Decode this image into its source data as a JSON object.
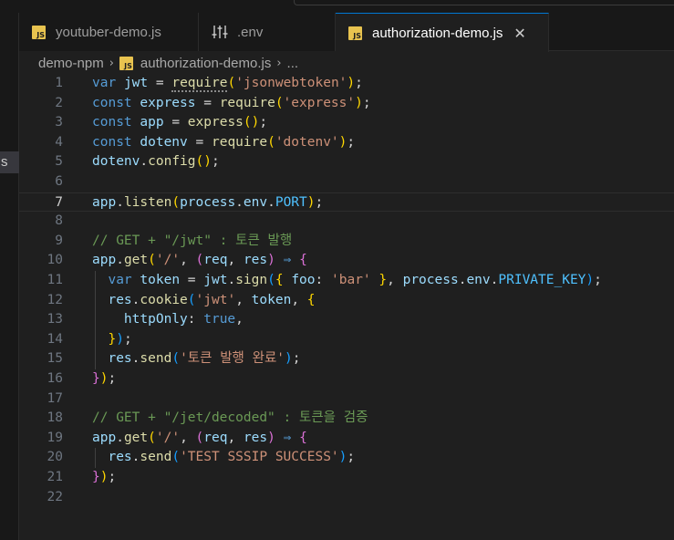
{
  "activity_bar": {
    "fragment": "s",
    "top_fragment": ""
  },
  "tabs": [
    {
      "label": "youtuber-demo.js",
      "icon": "js-file-icon",
      "icon_text": "JS"
    },
    {
      "label": ".env",
      "icon": "settings-sliders-icon"
    },
    {
      "label": "authorization-demo.js",
      "icon": "js-file-icon",
      "icon_text": "JS",
      "active": true,
      "close": "✕"
    }
  ],
  "breadcrumb": {
    "folder": "demo-npm",
    "file": "authorization-demo.js",
    "more": "...",
    "sep": "›",
    "icon_text": "JS"
  },
  "editor": {
    "current_line": 7,
    "colors": {
      "keyword": "#569cd6",
      "variable": "#9cdcfe",
      "function": "#dcdcaa",
      "string": "#ce9178",
      "comment": "#6a9955",
      "constant": "#4fc1ff"
    },
    "lines": [
      [
        [
          "kw",
          "var"
        ],
        [
          "p",
          " "
        ],
        [
          "vr",
          "jwt"
        ],
        [
          "p",
          " = "
        ],
        [
          "fn",
          "require"
        ],
        [
          "b1",
          "("
        ],
        [
          "st",
          "'jsonwebtoken'"
        ],
        [
          "b1",
          ")"
        ],
        [
          "p",
          ";"
        ]
      ],
      [
        [
          "kw",
          "const"
        ],
        [
          "p",
          " "
        ],
        [
          "vr",
          "express"
        ],
        [
          "p",
          " = "
        ],
        [
          "fn",
          "require"
        ],
        [
          "b1",
          "("
        ],
        [
          "st",
          "'express'"
        ],
        [
          "b1",
          ")"
        ],
        [
          "p",
          ";"
        ]
      ],
      [
        [
          "kw",
          "const"
        ],
        [
          "p",
          " "
        ],
        [
          "vr",
          "app"
        ],
        [
          "p",
          " = "
        ],
        [
          "fn",
          "express"
        ],
        [
          "b1",
          "()"
        ],
        [
          "p",
          ";"
        ]
      ],
      [
        [
          "kw",
          "const"
        ],
        [
          "p",
          " "
        ],
        [
          "vr",
          "dotenv"
        ],
        [
          "p",
          " = "
        ],
        [
          "fn",
          "require"
        ],
        [
          "b1",
          "("
        ],
        [
          "st",
          "'dotenv'"
        ],
        [
          "b1",
          ")"
        ],
        [
          "p",
          ";"
        ]
      ],
      [
        [
          "vr",
          "dotenv"
        ],
        [
          "p",
          "."
        ],
        [
          "fn",
          "config"
        ],
        [
          "b1",
          "()"
        ],
        [
          "p",
          ";"
        ]
      ],
      [],
      [
        [
          "vr",
          "app"
        ],
        [
          "p",
          "."
        ],
        [
          "fn",
          "listen"
        ],
        [
          "b1",
          "("
        ],
        [
          "vr",
          "process"
        ],
        [
          "p",
          "."
        ],
        [
          "vr",
          "env"
        ],
        [
          "p",
          "."
        ],
        [
          "cn",
          "PORT"
        ],
        [
          "b1",
          ")"
        ],
        [
          "p",
          ";"
        ]
      ],
      [],
      [
        [
          "cm",
          "// GET + \"/jwt\" : 토큰 발행"
        ]
      ],
      [
        [
          "vr",
          "app"
        ],
        [
          "p",
          "."
        ],
        [
          "fn",
          "get"
        ],
        [
          "b1",
          "("
        ],
        [
          "st",
          "'/'"
        ],
        [
          "p",
          ", "
        ],
        [
          "b2",
          "("
        ],
        [
          "vr",
          "req"
        ],
        [
          "p",
          ", "
        ],
        [
          "vr",
          "res"
        ],
        [
          "b2",
          ")"
        ],
        [
          "p",
          " "
        ],
        [
          "kw",
          "⇒"
        ],
        [
          "p",
          " "
        ],
        [
          "b2",
          "{"
        ]
      ],
      [
        [
          "p",
          "  "
        ],
        [
          "kw",
          "var"
        ],
        [
          "p",
          " "
        ],
        [
          "vr",
          "token"
        ],
        [
          "p",
          " = "
        ],
        [
          "vr",
          "jwt"
        ],
        [
          "p",
          "."
        ],
        [
          "fn",
          "sign"
        ],
        [
          "b3",
          "("
        ],
        [
          "b1",
          "{"
        ],
        [
          "p",
          " "
        ],
        [
          "vr",
          "foo"
        ],
        [
          "p",
          ": "
        ],
        [
          "st",
          "'bar'"
        ],
        [
          "p",
          " "
        ],
        [
          "b1",
          "}"
        ],
        [
          "p",
          ", "
        ],
        [
          "vr",
          "process"
        ],
        [
          "p",
          "."
        ],
        [
          "vr",
          "env"
        ],
        [
          "p",
          "."
        ],
        [
          "cn",
          "PRIVATE_KEY"
        ],
        [
          "b3",
          ")"
        ],
        [
          "p",
          ";"
        ]
      ],
      [
        [
          "p",
          "  "
        ],
        [
          "vr",
          "res"
        ],
        [
          "p",
          "."
        ],
        [
          "fn",
          "cookie"
        ],
        [
          "b3",
          "("
        ],
        [
          "st",
          "'jwt'"
        ],
        [
          "p",
          ", "
        ],
        [
          "vr",
          "token"
        ],
        [
          "p",
          ", "
        ],
        [
          "b1",
          "{"
        ]
      ],
      [
        [
          "p",
          "    "
        ],
        [
          "vr",
          "httpOnly"
        ],
        [
          "p",
          ": "
        ],
        [
          "kw",
          "true"
        ],
        [
          "p",
          ","
        ]
      ],
      [
        [
          "p",
          "  "
        ],
        [
          "b1",
          "}"
        ],
        [
          "b3",
          ")"
        ],
        [
          "p",
          ";"
        ]
      ],
      [
        [
          "p",
          "  "
        ],
        [
          "vr",
          "res"
        ],
        [
          "p",
          "."
        ],
        [
          "fn",
          "send"
        ],
        [
          "b3",
          "("
        ],
        [
          "st",
          "'토큰 발행 완료'"
        ],
        [
          "b3",
          ")"
        ],
        [
          "p",
          ";"
        ]
      ],
      [
        [
          "b2",
          "}"
        ],
        [
          "b1",
          ")"
        ],
        [
          "p",
          ";"
        ]
      ],
      [],
      [
        [
          "cm",
          "// GET + \"/jet/decoded\" : 토큰을 검증"
        ]
      ],
      [
        [
          "vr",
          "app"
        ],
        [
          "p",
          "."
        ],
        [
          "fn",
          "get"
        ],
        [
          "b1",
          "("
        ],
        [
          "st",
          "'/'"
        ],
        [
          "p",
          ", "
        ],
        [
          "b2",
          "("
        ],
        [
          "vr",
          "req"
        ],
        [
          "p",
          ", "
        ],
        [
          "vr",
          "res"
        ],
        [
          "b2",
          ")"
        ],
        [
          "p",
          " "
        ],
        [
          "kw",
          "⇒"
        ],
        [
          "p",
          " "
        ],
        [
          "b2",
          "{"
        ]
      ],
      [
        [
          "p",
          "  "
        ],
        [
          "vr",
          "res"
        ],
        [
          "p",
          "."
        ],
        [
          "fn",
          "send"
        ],
        [
          "b3",
          "("
        ],
        [
          "st",
          "'TEST SSSIP SUCCESS'"
        ],
        [
          "b3",
          ")"
        ],
        [
          "p",
          ";"
        ]
      ],
      [
        [
          "b2",
          "}"
        ],
        [
          "b1",
          ")"
        ],
        [
          "p",
          ";"
        ]
      ],
      []
    ]
  }
}
